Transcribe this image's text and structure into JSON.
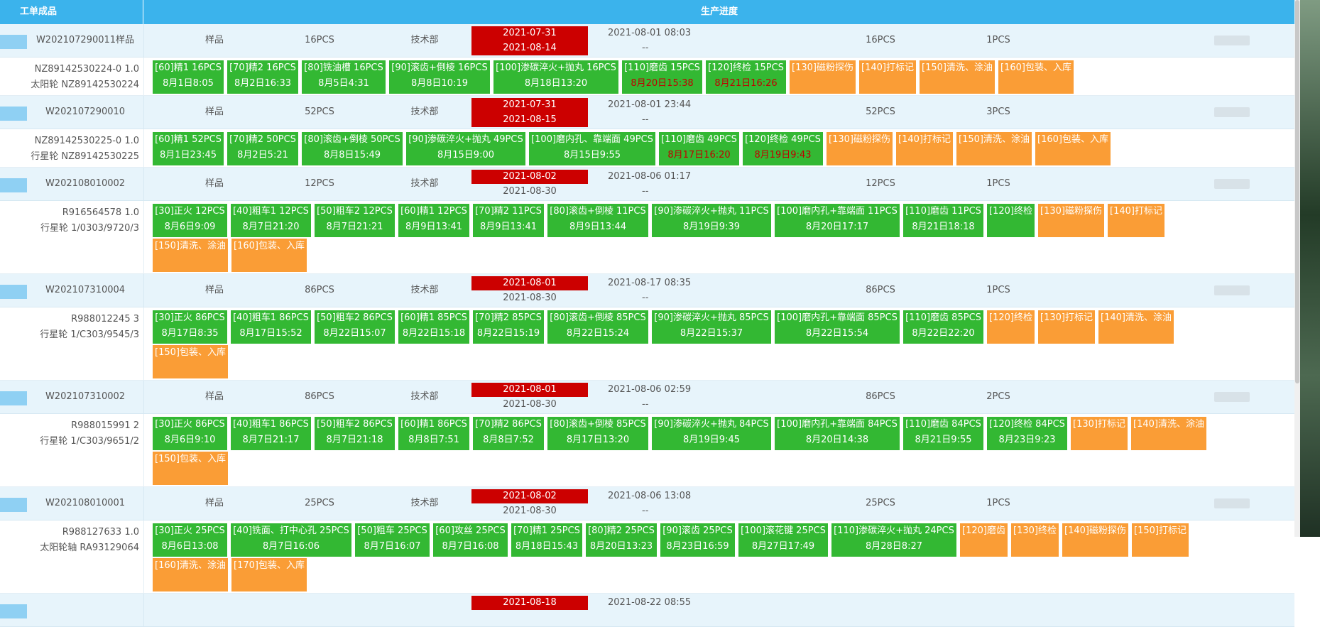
{
  "header": {
    "col1": "工单成品",
    "col2": "生产进度"
  },
  "orders": [
    {
      "wo": "W202107290011样品",
      "type": "样品",
      "qty": "16PCS",
      "dept": "技术部",
      "date1": "2021-07-31",
      "date2": "2021-08-14",
      "date2_red": true,
      "start": "2021-08-01 08:03",
      "start2": "--",
      "qty2": "16PCS",
      "qty3": "1PCS",
      "part1": "NZ89142530224-0  1.0",
      "part2": "太阳轮  NZ89142530224",
      "steps": [
        {
          "t": "[60]精1 16PCS",
          "d": "8月1日8:05",
          "c": "green"
        },
        {
          "t": "[70]精2 16PCS",
          "d": "8月2日16:33",
          "c": "green"
        },
        {
          "t": "[80]铣油槽 16PCS",
          "d": "8月5日4:31",
          "c": "green"
        },
        {
          "t": "[90]滚齿+倒棱 16PCS",
          "d": "8月8日10:19",
          "c": "green"
        },
        {
          "t": "[100]渗碳淬火+抛丸 16PCS",
          "d": "8月18日13:20",
          "c": "green"
        },
        {
          "t": "[110]磨齿 15PCS",
          "d": "8月20日15:38",
          "c": "green",
          "late": true
        },
        {
          "t": "[120]终检 15PCS",
          "d": "8月21日16:26",
          "c": "green",
          "late": true
        },
        {
          "t": "[130]磁粉探伤",
          "d": "",
          "c": "orange"
        },
        {
          "t": "[140]打标记",
          "d": "",
          "c": "orange"
        },
        {
          "t": "[150]清洗、涂油",
          "d": "",
          "c": "orange"
        },
        {
          "t": "[160]包装、入库",
          "d": "",
          "c": "orange"
        }
      ]
    },
    {
      "wo": "W202107290010",
      "type": "样品",
      "qty": "52PCS",
      "dept": "技术部",
      "date1": "2021-07-31",
      "date2": "2021-08-15",
      "date2_red": true,
      "start": "2021-08-01 23:44",
      "start2": "--",
      "qty2": "52PCS",
      "qty3": "3PCS",
      "part1": "NZ89142530225-0  1.0",
      "part2": "行星轮  NZ89142530225",
      "steps": [
        {
          "t": "[60]精1 52PCS",
          "d": "8月1日23:45",
          "c": "green"
        },
        {
          "t": "[70]精2 50PCS",
          "d": "8月2日5:21",
          "c": "green"
        },
        {
          "t": "[80]滚齿+倒棱 50PCS",
          "d": "8月8日15:49",
          "c": "green"
        },
        {
          "t": "[90]渗碳淬火+抛丸 49PCS",
          "d": "8月15日9:00",
          "c": "green"
        },
        {
          "t": "[100]磨内孔、靠端面 49PCS",
          "d": "8月15日9:55",
          "c": "green"
        },
        {
          "t": "[110]磨齿 49PCS",
          "d": "8月17日16:20",
          "c": "green",
          "late": true
        },
        {
          "t": "[120]终检 49PCS",
          "d": "8月19日9:43",
          "c": "green",
          "late": true
        },
        {
          "t": "[130]磁粉探伤",
          "d": "",
          "c": "orange"
        },
        {
          "t": "[140]打标记",
          "d": "",
          "c": "orange"
        },
        {
          "t": "[150]清洗、涂油",
          "d": "",
          "c": "orange"
        },
        {
          "t": "[160]包装、入库",
          "d": "",
          "c": "orange"
        }
      ]
    },
    {
      "wo": "W202108010002",
      "type": "样品",
      "qty": "12PCS",
      "dept": "技术部",
      "date1": "2021-08-02",
      "date2": "2021-08-30",
      "date2_red": false,
      "start": "2021-08-06 01:17",
      "start2": "--",
      "qty2": "12PCS",
      "qty3": "1PCS",
      "part1": "R916564578  1.0",
      "part2": "行星轮  1/0303/9720/3",
      "steps": [
        {
          "t": "[30]正火 12PCS",
          "d": "8月6日9:09",
          "c": "green"
        },
        {
          "t": "[40]粗车1 12PCS",
          "d": "8月7日21:20",
          "c": "green"
        },
        {
          "t": "[50]粗车2 12PCS",
          "d": "8月7日21:21",
          "c": "green"
        },
        {
          "t": "[60]精1 12PCS",
          "d": "8月9日13:41",
          "c": "green"
        },
        {
          "t": "[70]精2 11PCS",
          "d": "8月9日13:41",
          "c": "green"
        },
        {
          "t": "[80]滚齿+倒棱 11PCS",
          "d": "8月9日13:44",
          "c": "green"
        },
        {
          "t": "[90]渗碳淬火+抛丸 11PCS",
          "d": "8月19日9:39",
          "c": "green"
        },
        {
          "t": "[100]磨内孔+靠端面 11PCS",
          "d": "8月20日17:17",
          "c": "green"
        },
        {
          "t": "[110]磨齿 11PCS",
          "d": "8月21日18:18",
          "c": "green"
        },
        {
          "t": "[120]终检",
          "d": "",
          "c": "green"
        },
        {
          "t": "[130]磁粉探伤",
          "d": "",
          "c": "orange"
        },
        {
          "t": "[140]打标记",
          "d": "",
          "c": "orange"
        },
        {
          "t": "[150]清洗、涂油",
          "d": "",
          "c": "orange"
        },
        {
          "t": "[160]包装、入库",
          "d": "",
          "c": "orange"
        }
      ]
    },
    {
      "wo": "W202107310004",
      "type": "样品",
      "qty": "86PCS",
      "dept": "技术部",
      "date1": "2021-08-01",
      "date2": "2021-08-30",
      "date2_red": false,
      "start": "2021-08-17 08:35",
      "start2": "--",
      "qty2": "86PCS",
      "qty3": "1PCS",
      "part1": "R988012245  3",
      "part2": "行星轮  1/C303/9545/3",
      "steps": [
        {
          "t": "[30]正火 86PCS",
          "d": "8月17日8:35",
          "c": "green"
        },
        {
          "t": "[40]粗车1 86PCS",
          "d": "8月17日15:52",
          "c": "green"
        },
        {
          "t": "[50]粗车2 86PCS",
          "d": "8月22日15:07",
          "c": "green"
        },
        {
          "t": "[60]精1 85PCS",
          "d": "8月22日15:18",
          "c": "green"
        },
        {
          "t": "[70]精2 85PCS",
          "d": "8月22日15:19",
          "c": "green"
        },
        {
          "t": "[80]滚齿+倒棱 85PCS",
          "d": "8月22日15:24",
          "c": "green"
        },
        {
          "t": "[90]渗碳淬火+抛丸 85PCS",
          "d": "8月22日15:37",
          "c": "green"
        },
        {
          "t": "[100]磨内孔+靠端面 85PCS",
          "d": "8月22日15:54",
          "c": "green"
        },
        {
          "t": "[110]磨齿 85PCS",
          "d": "8月22日22:20",
          "c": "green"
        },
        {
          "t": "[120]终检",
          "d": "",
          "c": "orange"
        },
        {
          "t": "[130]打标记",
          "d": "",
          "c": "orange"
        },
        {
          "t": "[140]清洗、涂油",
          "d": "",
          "c": "orange"
        },
        {
          "t": "[150]包装、入库",
          "d": "",
          "c": "orange"
        }
      ]
    },
    {
      "wo": "W202107310002",
      "type": "样品",
      "qty": "86PCS",
      "dept": "技术部",
      "date1": "2021-08-01",
      "date2": "2021-08-30",
      "date2_red": false,
      "start": "2021-08-06 02:59",
      "start2": "--",
      "qty2": "86PCS",
      "qty3": "2PCS",
      "part1": "R988015991  2",
      "part2": "行星轮  1/C303/9651/2",
      "steps": [
        {
          "t": "[30]正火 86PCS",
          "d": "8月6日9:10",
          "c": "green"
        },
        {
          "t": "[40]粗车1 86PCS",
          "d": "8月7日21:17",
          "c": "green"
        },
        {
          "t": "[50]粗车2 86PCS",
          "d": "8月7日21:18",
          "c": "green"
        },
        {
          "t": "[60]精1 86PCS",
          "d": "8月8日7:51",
          "c": "green"
        },
        {
          "t": "[70]精2 86PCS",
          "d": "8月8日7:52",
          "c": "green"
        },
        {
          "t": "[80]滚齿+倒棱 85PCS",
          "d": "8月17日13:20",
          "c": "green"
        },
        {
          "t": "[90]渗碳淬火+抛丸 84PCS",
          "d": "8月19日9:45",
          "c": "green"
        },
        {
          "t": "[100]磨内孔+靠端面 84PCS",
          "d": "8月20日14:38",
          "c": "green"
        },
        {
          "t": "[110]磨齿 84PCS",
          "d": "8月21日9:55",
          "c": "green"
        },
        {
          "t": "[120]终检 84PCS",
          "d": "8月23日9:23",
          "c": "green"
        },
        {
          "t": "[130]打标记",
          "d": "",
          "c": "orange"
        },
        {
          "t": "[140]清洗、涂油",
          "d": "",
          "c": "orange"
        },
        {
          "t": "[150]包装、入库",
          "d": "",
          "c": "orange"
        }
      ]
    },
    {
      "wo": "W202108010001",
      "type": "样品",
      "qty": "25PCS",
      "dept": "技术部",
      "date1": "2021-08-02",
      "date2": "2021-08-30",
      "date2_red": false,
      "start": "2021-08-06 13:08",
      "start2": "--",
      "qty2": "25PCS",
      "qty3": "1PCS",
      "part1": "R988127633  1.0",
      "part2": "太阳轮轴  RA93129064",
      "steps": [
        {
          "t": "[30]正火 25PCS",
          "d": "8月6日13:08",
          "c": "green"
        },
        {
          "t": "[40]铣面、打中心孔 25PCS",
          "d": "8月7日16:06",
          "c": "green"
        },
        {
          "t": "[50]粗车 25PCS",
          "d": "8月7日16:07",
          "c": "green"
        },
        {
          "t": "[60]攻丝 25PCS",
          "d": "8月7日16:08",
          "c": "green"
        },
        {
          "t": "[70]精1 25PCS",
          "d": "8月18日15:43",
          "c": "green"
        },
        {
          "t": "[80]精2 25PCS",
          "d": "8月20日13:23",
          "c": "green"
        },
        {
          "t": "[90]滚齿 25PCS",
          "d": "8月23日16:59",
          "c": "green"
        },
        {
          "t": "[100]滚花键 25PCS",
          "d": "8月27日17:49",
          "c": "green"
        },
        {
          "t": "[110]渗碳淬火+抛丸 24PCS",
          "d": "8月28日8:27",
          "c": "green"
        },
        {
          "t": "[120]磨齿",
          "d": "",
          "c": "orange"
        },
        {
          "t": "[130]终检",
          "d": "",
          "c": "orange"
        },
        {
          "t": "[140]磁粉探伤",
          "d": "",
          "c": "orange"
        },
        {
          "t": "[150]打标记",
          "d": "",
          "c": "orange"
        },
        {
          "t": "[160]清洗、涂油",
          "d": "",
          "c": "orange"
        },
        {
          "t": "[170]包装、入库",
          "d": "",
          "c": "orange"
        }
      ]
    },
    {
      "wo": "",
      "type": "",
      "qty": "",
      "dept": "",
      "date1": "2021-08-18",
      "date2": "",
      "date2_red": false,
      "start": "2021-08-22 08:55",
      "start2": "",
      "qty2": "",
      "qty3": "",
      "part1": "",
      "part2": "",
      "steps": []
    }
  ]
}
